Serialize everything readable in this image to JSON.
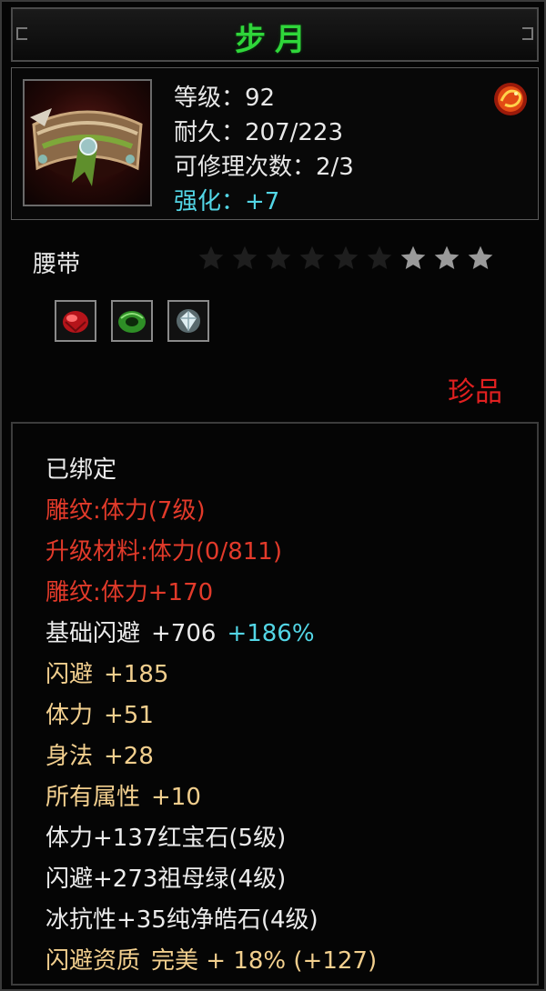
{
  "item": {
    "name": "步月",
    "level_label": "等级：92",
    "durability_label": "耐久：207/223",
    "repair_label": "可修理次数：2/3",
    "enhance_label": "强化：+7",
    "type": "腰带",
    "rarity": "珍品",
    "stars_filled": 3,
    "stars_total": 9
  },
  "gems": [
    {
      "name": "ruby-gem-icon",
      "color": "#c8161c"
    },
    {
      "name": "emerald-gem-icon",
      "color": "#2f9a2a"
    },
    {
      "name": "diamond-gem-icon",
      "color": "#cfe0e8"
    }
  ],
  "attributes": {
    "bound": "已绑定",
    "engrave": "雕纹:体力(7级)",
    "upgrade_material": "升级材料:体力(0/811)",
    "engrave_bonus": "雕纹:体力+170",
    "base_dodge": "基础闪避",
    "base_dodge_value": "+706",
    "base_dodge_pct": "+186%",
    "dodge": "闪避",
    "dodge_value": "+185",
    "vitality": "体力",
    "vitality_value": "+51",
    "agility": "身法",
    "agility_value": "+28",
    "all_attr": "所有属性",
    "all_attr_value": "+10",
    "gem_line_1": "体力+137红宝石(5级)",
    "gem_line_2": "闪避+273祖母绿(4级)",
    "gem_line_3": "冰抗性+35纯净皓石(4级)",
    "aptitude": "闪避资质",
    "aptitude_value": "完美 + 18% (+127)"
  },
  "colors": {
    "title": "#2fd63a",
    "red": "#e23a2a",
    "gold": "#f2cf8e",
    "cyan": "#53d6e6",
    "white": "#ececec"
  }
}
